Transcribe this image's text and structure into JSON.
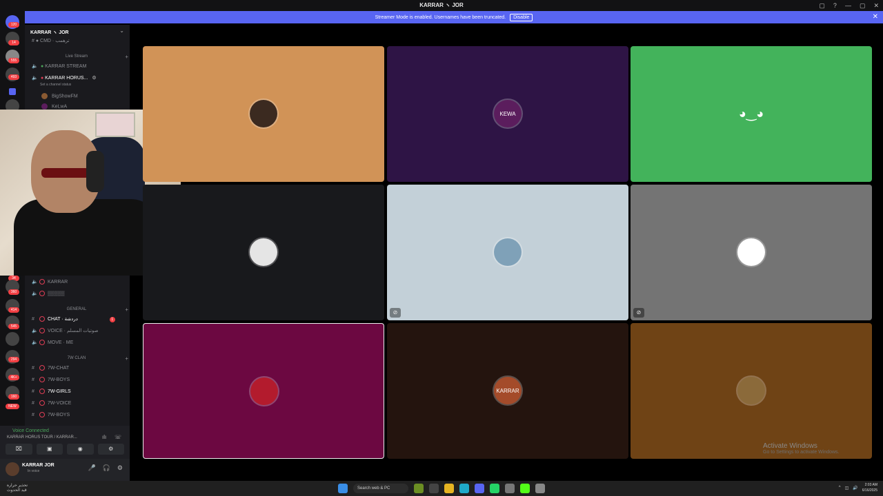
{
  "window": {
    "title": "KARRAR ヽ JOR",
    "controls": [
      "▢",
      "?",
      "—",
      "▢",
      "✕"
    ]
  },
  "banner": {
    "text": "Streamer Mode is enabled. Usernames have been truncated.",
    "button": "Disable",
    "close": "✕"
  },
  "server": {
    "name": "KARRAR ヽ JOR",
    "chevron": "⌄"
  },
  "rail": {
    "badges": [
      "120",
      "14",
      "555",
      "493",
      "34",
      "360",
      "414",
      "545",
      "294",
      "4K+",
      "160",
      "NEW"
    ]
  },
  "channels": {
    "top": "# ●  CMD · ترهمب",
    "category_live": "Live Stream",
    "live_stream": "KARRAR STREAM",
    "horus": "KARRAR HORUS...",
    "status": "Set a channel status",
    "users": [
      "BigShowFM",
      "KeLwA"
    ],
    "karrar": "KARRAR",
    "hidden": "▒▒▒▒▒",
    "category_general": "GENERAL",
    "chat": "CHAT · دردشة",
    "chat_badge": "1",
    "voice": "VOICE · صوتيات المسلم",
    "move": "MOVE · ME",
    "category_clan": "7W CLAN",
    "clan": [
      "7W-CHAT",
      "7W-BOYS",
      "7W-GIRLS",
      "7W-VOICE",
      "7W-BOYS"
    ]
  },
  "voice_panel": {
    "connected": "Voice Connected",
    "channel": "KARRAR HORUS TOUR / KARRAR...",
    "buttons": [
      "⌧",
      "▣",
      "◉",
      "⚙"
    ]
  },
  "user": {
    "name": "KARRAR JOR",
    "status": "In voice"
  },
  "tiles": [
    {
      "color": "#d19357",
      "avatar": "#3b2a20",
      "label": "",
      "muted": false
    },
    {
      "color": "#2e1445",
      "avatar": "#5b1d5d",
      "label": "KEWA",
      "muted": false
    },
    {
      "color": "#43b35b",
      "avatar": "#43b35b",
      "label": "discord-logo",
      "muted": false
    },
    {
      "color": "#18191c",
      "avatar": "#e5e5e5",
      "label": "",
      "muted": false
    },
    {
      "color": "#c3d0d8",
      "avatar": "#7fa1b8",
      "label": "",
      "muted": true
    },
    {
      "color": "#747474",
      "avatar": "#ffffff",
      "label": "",
      "muted": true
    },
    {
      "color": "#6c0841",
      "avatar": "#b31b2d",
      "label": "",
      "muted": false
    },
    {
      "color": "#24140e",
      "avatar": "#a44b2a",
      "label": "KARRAR",
      "muted": false
    },
    {
      "color": "#6f4315",
      "avatar": "#8b6a3a",
      "label": "",
      "muted": false
    }
  ],
  "watermark": {
    "title": "Activate Windows",
    "sub": "Go to Settings to activate Windows."
  },
  "taskbar": {
    "weather": "تحذير حرارة\nقيد الحدوث",
    "search": "Search web & PC",
    "time": "2:03 AM",
    "date": "6/16/2025"
  }
}
